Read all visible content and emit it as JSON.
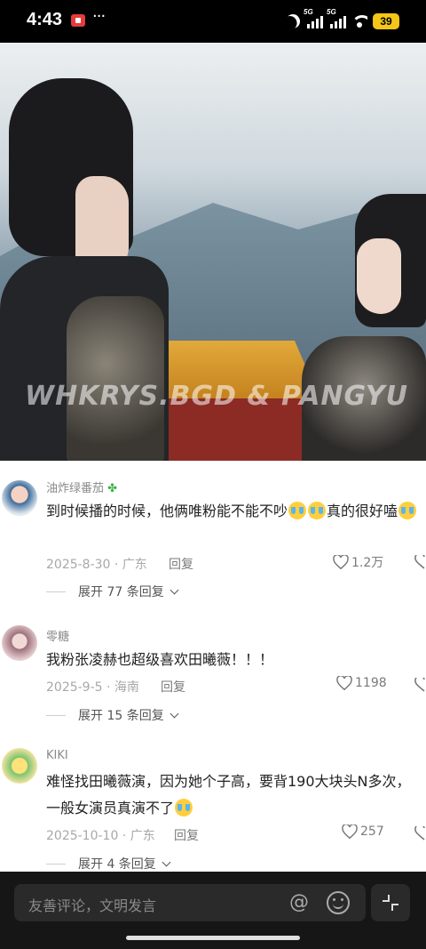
{
  "status_bar": {
    "time": "4:43",
    "icons": [
      "screen-record-icon",
      "more-dots-icon",
      "moon-icon",
      "signal-5g-icon",
      "signal-5g-icon",
      "wifi-icon",
      "battery-icon"
    ],
    "network_1": "5G",
    "network_2": "5G",
    "battery": "39"
  },
  "video": {
    "watermark": "WHKRYS.BGD & PANGYU"
  },
  "comments": [
    {
      "username": "油炸绿番茄",
      "text_a": "到时候播的时候，他俩唯粉能不能不吵",
      "text_b": "真的很好嗑",
      "date_location": "2025-8-30 · 广东",
      "reply": "回复",
      "likes": "1.2万",
      "expand": "展开 77 条回复"
    },
    {
      "username": "零糖",
      "text": "我粉张凌赫也超级喜欢田曦薇！！！",
      "date_location": "2025-9-5 · 海南",
      "reply": "回复",
      "likes": "1198",
      "expand": "展开 15 条回复"
    },
    {
      "username": "KIKI",
      "text": "难怪找田曦薇演，因为她个子高，要背190大块头N多次，一般女演员真演不了",
      "date_location": "2025-10-10 · 广东",
      "reply": "回复",
      "likes": "257",
      "expand": "展开 4 条回复"
    }
  ],
  "input": {
    "placeholder": "友善评论，文明发言"
  },
  "colors": {
    "background_dark": "#161616",
    "comment_bg": "#ffffff",
    "battery": "#f5c518"
  }
}
